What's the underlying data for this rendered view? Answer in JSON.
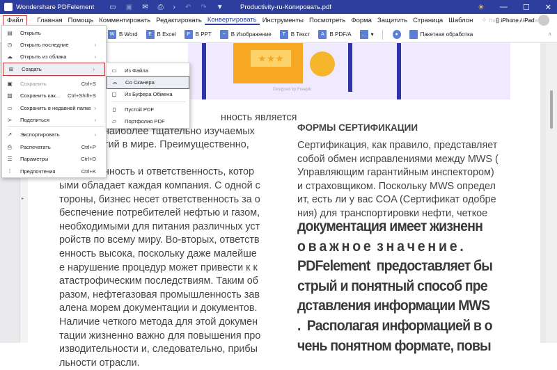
{
  "titlebar": {
    "app": "Wondershare PDFelement",
    "doc_title": "Productivity-ru-Копировать.pdf"
  },
  "menu": {
    "items": [
      "Файл",
      "Главная",
      "Помощь",
      "Комментировать",
      "Редактировать",
      "Конвертировать",
      "Инструменты",
      "Посмотреть",
      "Форма",
      "Защитить",
      "Страница",
      "Шаблон"
    ],
    "search_placeholder": "Поиск инструментов",
    "device": "iPhone / iPad"
  },
  "toolbar": {
    "items": [
      {
        "icon": "W",
        "label": "В Word"
      },
      {
        "icon": "E",
        "label": "В Excel"
      },
      {
        "icon": "P",
        "label": "В PPT"
      },
      {
        "icon": "~",
        "label": "В Изображение"
      },
      {
        "icon": "T",
        "label": "В Текст"
      },
      {
        "icon": "A",
        "label": "В PDF/A"
      }
    ],
    "batch": "Пакетная обработка"
  },
  "file_menu": [
    {
      "icon": "▤",
      "label": "Открыть",
      "shortcut": "",
      "arrow": ""
    },
    {
      "icon": "◷",
      "label": "Открыть последние",
      "shortcut": "",
      "arrow": "›"
    },
    {
      "icon": "☁",
      "label": "Открыть из облака",
      "shortcut": "",
      "arrow": "›"
    },
    {
      "icon": "⊞",
      "label": "Создать",
      "shortcut": "",
      "arrow": "›"
    },
    {
      "icon": "▣",
      "label": "Сохранить",
      "shortcut": "Ctrl+S",
      "arrow": ""
    },
    {
      "icon": "▨",
      "label": "Сохранить как...",
      "shortcut": "Ctrl+Shift+S",
      "arrow": ""
    },
    {
      "icon": "▭",
      "label": "Сохранить в недавней папке",
      "shortcut": "",
      "arrow": "›"
    },
    {
      "icon": "≻",
      "label": "Поделиться",
      "shortcut": "",
      "arrow": "›"
    },
    {
      "icon": "↗",
      "label": "Экспортировать",
      "shortcut": "",
      "arrow": "›"
    },
    {
      "icon": "⎙",
      "label": "Распечатать",
      "shortcut": "Ctrl+P",
      "arrow": ""
    },
    {
      "icon": "☰",
      "label": "Параметры",
      "shortcut": "Ctrl+D",
      "arrow": ""
    },
    {
      "icon": "⁞",
      "label": "Предпочтения",
      "shortcut": "Ctrl+K",
      "arrow": ""
    }
  ],
  "create_submenu": [
    {
      "icon": "▭",
      "label": "Из Файла"
    },
    {
      "icon": "⌓",
      "label": "Со Сканера"
    },
    {
      "icon": "▢",
      "label": "Из Буфера Обмена"
    },
    {
      "icon": "▯",
      "label": "Пустой PDF"
    },
    {
      "icon": "▱",
      "label": "Портфолио PDF"
    }
  ],
  "banner_credit": "Designed by Freepik",
  "left_text": [
    "нность является",
    "наиболее тщательно изучаемых",
    "тий в мире. Преимущественно,",
    "",
    "нность и ответственность, котор",
    "ыми обладает каждая компания. С одной с",
    "тороны, бизнес несет ответственность за о",
    "беспечение потребителей нефтью и газом,",
    "необходимыми для питания различных уст",
    "ройств по всему миру. Во-вторых, ответств",
    "енность высока, поскольку даже малейше",
    "е нарушение процедур может привести к к",
    "атастрофическим последствиям. Таким об",
    "разом, нефтегазовая промышленность зав",
    "алена морем документации и документов.",
    "Наличие четкого метода для этой докумен",
    "тации жизненно важно для повышения про",
    "изводительности и, следовательно, прибы",
    "льности отрасли."
  ],
  "right_heading": "ФОРМЫ СЕРТИФИКАЦИИ",
  "right_text": [
    "Сертификация, как правило, представляет",
    "собой обмен исправлениями между MWS (",
    "Управляющим гарантийным инспектором)",
    "и страховщиком.  Поскольку MWS определ",
    "ит, есть ли у вас COA (Сертификат одобре",
    "ния) для транспортировки нефти, четкое"
  ],
  "right_big": [
    "документация имеет жизненн",
    "о в а ж н о е  з н а ч е н и е .",
    "PDFelement  предоставляет бы",
    "стрый и понятный способ пре",
    "дставления информации MWS",
    ".  Располагая информацией в о",
    "чень понятном формате, повы"
  ]
}
